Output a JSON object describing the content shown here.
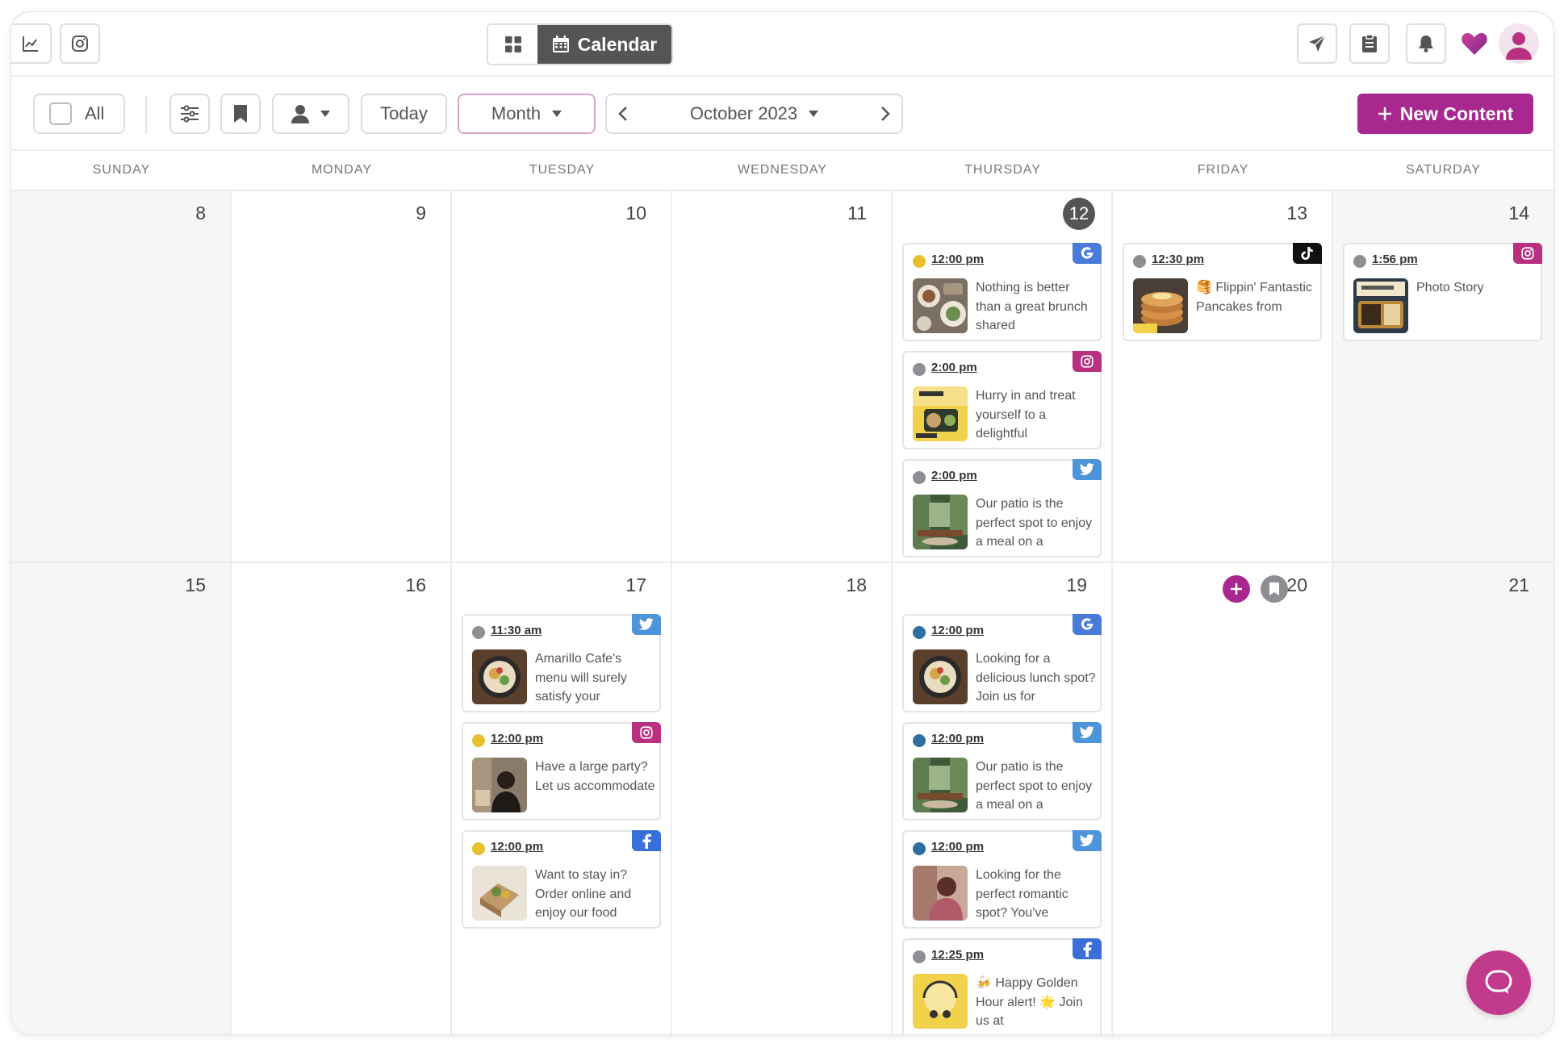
{
  "header": {
    "view_label": "Calendar"
  },
  "toolbar": {
    "all_label": "All",
    "today_label": "Today",
    "view_select": "Month",
    "period": "October 2023",
    "new_content_label": "New Content"
  },
  "days_of_week": [
    "SUNDAY",
    "MONDAY",
    "TUESDAY",
    "WEDNESDAY",
    "THURSDAY",
    "FRIDAY",
    "SATURDAY"
  ],
  "week1": {
    "dates": [
      "8",
      "9",
      "10",
      "11",
      "12",
      "13",
      "14"
    ],
    "thu_posts": [
      {
        "time": "12:00 pm",
        "text": "Nothing is better than a great brunch shared",
        "network": "google",
        "status_color": "#e8bf2c"
      },
      {
        "time": "2:00 pm",
        "text": "Hurry in and treat yourself to a delightful",
        "network": "instagram",
        "status_color": "#8e8e93"
      },
      {
        "time": "2:00 pm",
        "text": "Our patio is the perfect spot to enjoy a meal on a",
        "network": "twitter",
        "status_color": "#8e8e93"
      }
    ],
    "fri_posts": [
      {
        "time": "12:30 pm",
        "text": "🥞 Flippin' Fantastic Pancakes from",
        "network": "tiktok",
        "status_color": "#8e8e93"
      }
    ],
    "sat_posts": [
      {
        "time": "1:56 pm",
        "text": "Photo Story",
        "network": "instagram",
        "status_color": "#8e8e93"
      }
    ]
  },
  "week2": {
    "dates": [
      "15",
      "16",
      "17",
      "18",
      "19",
      "20",
      "21"
    ],
    "tue_posts": [
      {
        "time": "11:30 am",
        "text": "Amarillo Cafe's menu will surely satisfy your",
        "network": "twitter",
        "status_color": "#8e8e93"
      },
      {
        "time": "12:00 pm",
        "text": "Have a large party? Let us accommodate",
        "network": "instagram",
        "status_color": "#e8bf2c"
      },
      {
        "time": "12:00 pm",
        "text": "Want to stay in? Order online and enjoy our food",
        "network": "facebook",
        "status_color": "#e8bf2c"
      }
    ],
    "thu_posts": [
      {
        "time": "12:00 pm",
        "text": "Looking for a delicious lunch spot? Join us for",
        "network": "google",
        "status_color": "#2f6ea0"
      },
      {
        "time": "12:00 pm",
        "text": "Our patio is the perfect spot to enjoy a meal on a",
        "network": "twitter",
        "status_color": "#2f6ea0"
      },
      {
        "time": "12:00 pm",
        "text": "Looking for the perfect romantic spot? You've",
        "network": "twitter",
        "status_color": "#2f6ea0"
      },
      {
        "time": "12:25 pm",
        "text": "🍻 Happy Golden Hour alert! 🌟 Join us at",
        "network": "facebook",
        "status_color": "#8e8e93"
      }
    ]
  },
  "colors": {
    "accent": "#a8288f",
    "dark_button": "#555457",
    "google": "#4a7bd8",
    "instagram": "#b8307f",
    "twitter": "#4e94d8",
    "facebook": "#3a6fd8",
    "tiktok": "#111111"
  },
  "icons": [
    "analytics-icon",
    "instagram-icon",
    "grid-icon",
    "calendar-icon",
    "send-icon",
    "clipboard-icon",
    "bell-icon",
    "heart-icon",
    "avatar",
    "filter-icon",
    "bookmark-icon",
    "person-icon",
    "chevron-down-icon",
    "chevron-left-icon",
    "chevron-right-icon",
    "plus-icon",
    "chat-icon"
  ]
}
